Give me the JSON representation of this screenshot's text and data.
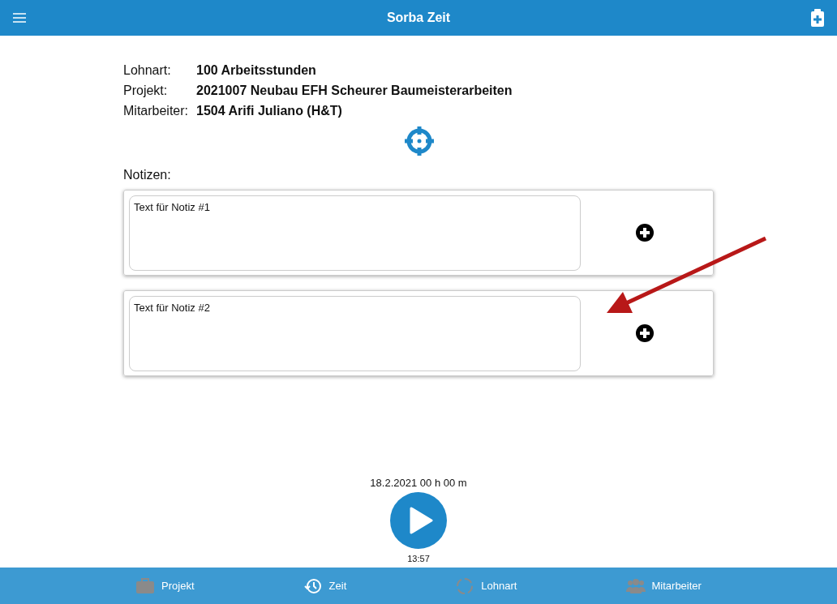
{
  "header": {
    "title": "Sorba Zeit"
  },
  "details": [
    {
      "label": "Lohnart:",
      "value": "100 Arbeitsstunden"
    },
    {
      "label": "Projekt:",
      "value": "2021007 Neubau EFH Scheurer Baumeisterarbeiten"
    },
    {
      "label": "Mitarbeiter:",
      "value": "1504 Arifi Juliano (H&T)"
    }
  ],
  "notes": {
    "label": "Notizen:",
    "items": [
      {
        "value": "Text für Notiz #1"
      },
      {
        "value": "Text für Notiz #2"
      }
    ]
  },
  "timer": {
    "date": "18.2.2021 00 h 00 m",
    "time": "13:57"
  },
  "tabs": [
    {
      "label": "Projekt",
      "kind": "briefcase",
      "selected": false
    },
    {
      "label": "Zeit",
      "kind": "clock",
      "selected": true
    },
    {
      "label": "Lohnart",
      "kind": "cycle",
      "selected": false
    },
    {
      "label": "Mitarbeiter",
      "kind": "people",
      "selected": false
    }
  ]
}
